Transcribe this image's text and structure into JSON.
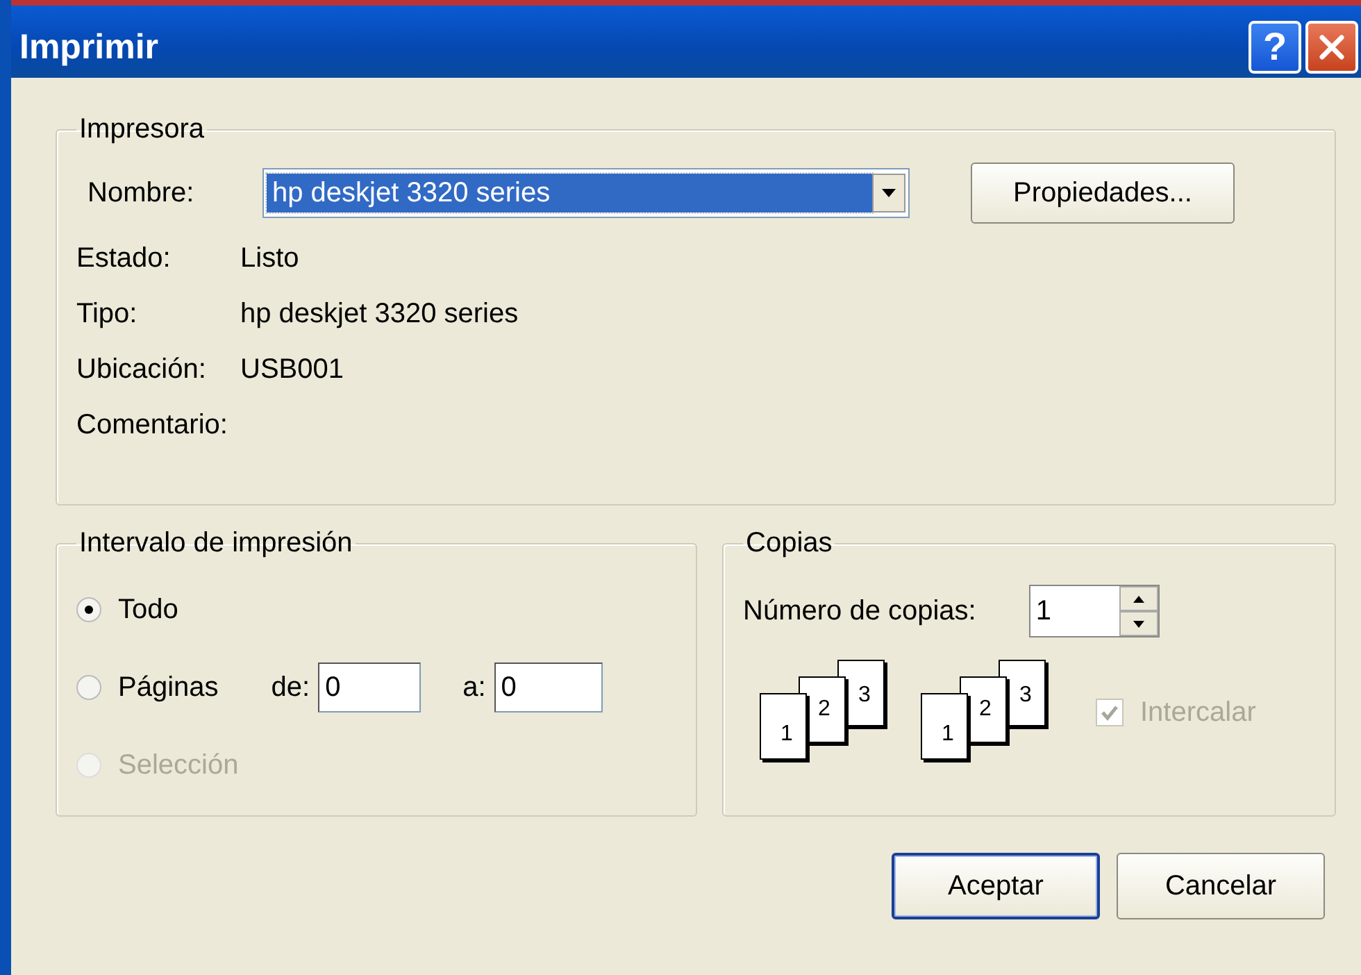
{
  "window": {
    "title": "Imprimir",
    "title_buttons": [
      {
        "kind": "help",
        "label": "?"
      },
      {
        "kind": "close"
      }
    ]
  },
  "printer": {
    "title": "Impresora",
    "name_label": "Nombre:",
    "name_value": "hp deskjet 3320 series",
    "name_highlighted": true,
    "properties_button": "Propiedades...",
    "info": [
      {
        "label": "Estado:",
        "value": "Listo"
      },
      {
        "label": "Tipo:",
        "value": "hp deskjet 3320 series"
      },
      {
        "label": "Ubicación:",
        "value": "USB001"
      },
      {
        "label": "Comentario:"
      }
    ]
  },
  "range": {
    "title": "Intervalo de impresión",
    "options": [
      {
        "label": "Todo",
        "selected": true,
        "disabled": false
      },
      {
        "label": "Páginas",
        "selected": false,
        "disabled": false
      },
      {
        "label": "Selección",
        "selected": false,
        "disabled": true
      }
    ],
    "from": {
      "label": "de:",
      "value": "0"
    },
    "to": {
      "label": "a:",
      "value": "0"
    }
  },
  "copies": {
    "title": "Copias",
    "count_label": "Número de copias:",
    "count_value": "1",
    "stacks": [
      [
        "1",
        "2",
        "3"
      ],
      [
        "1",
        "2",
        "3"
      ]
    ],
    "collate": {
      "label": "Intercalar",
      "checked": true,
      "disabled": true
    }
  },
  "buttons": [
    {
      "label": "Aceptar",
      "default": true
    },
    {
      "label": "Cancelar",
      "default": false
    }
  ]
}
